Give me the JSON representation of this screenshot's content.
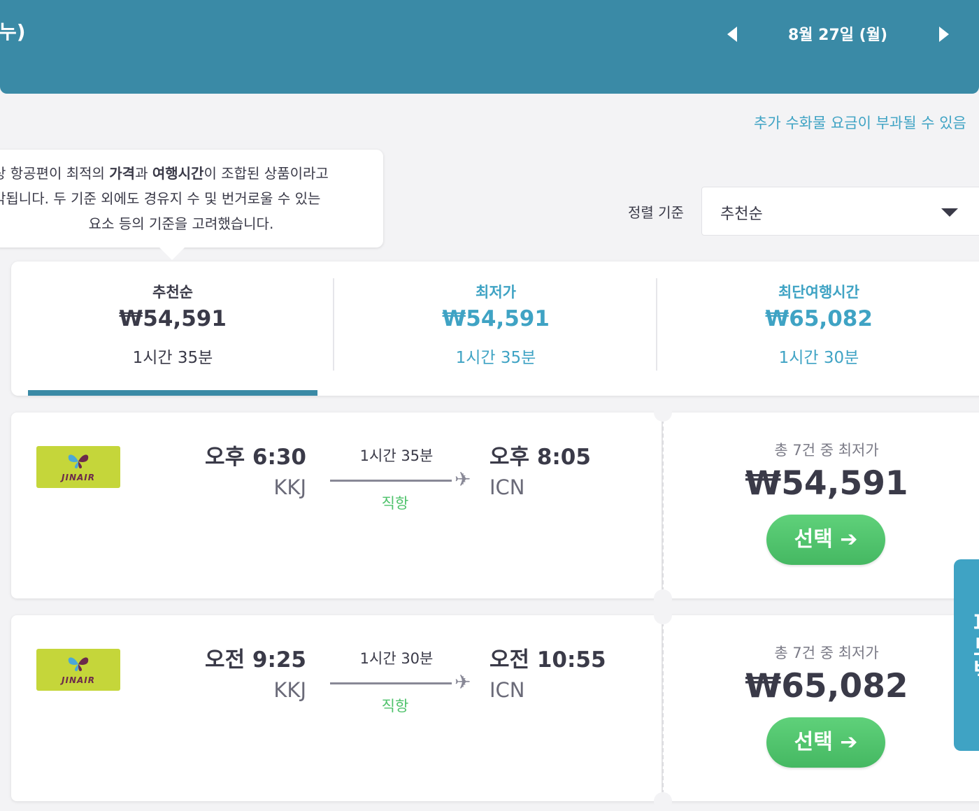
{
  "header": {
    "left_text": "누)",
    "date": "8월 27일 (월)"
  },
  "notice": {
    "baggage": "추가 수화물 요금이 부과될 수 있음"
  },
  "tooltip": {
    "line1_pre": "상 항공편이 최적의 ",
    "line1_b1": "가격",
    "line1_mid": "과 ",
    "line1_b2": "여행시간",
    "line1_post": "이 조합된 상품이라고",
    "line2": "각됩니다. 두 기준 외에도 경유지 수 및 번거로울 수 있는",
    "line3": "요소 등의 기준을 고려했습니다."
  },
  "sort": {
    "label": "정렬 기준",
    "value": "추천순"
  },
  "tabs": [
    {
      "title": "추천순",
      "price": "₩54,591",
      "duration": "1시간 35분"
    },
    {
      "title": "최저가",
      "price": "₩54,591",
      "duration": "1시간 35분"
    },
    {
      "title": "최단여행시간",
      "price": "₩65,082",
      "duration": "1시간 30분"
    }
  ],
  "flights": [
    {
      "airline_logo_text": "JINAIR",
      "dep_time": "오후 6:30",
      "dep_airport": "KKJ",
      "duration": "1시간 35분",
      "type": "직항",
      "arr_time": "오후 8:05",
      "arr_airport": "ICN",
      "offer_count": "총 7건 중 최저가",
      "price": "₩54,591",
      "select_label": "선택"
    },
    {
      "airline_logo_text": "JINAIR",
      "dep_time": "오전 9:25",
      "dep_airport": "KKJ",
      "duration": "1시간 30분",
      "type": "직항",
      "arr_time": "오전 10:55",
      "arr_airport": "ICN",
      "offer_count": "총 7건 중 최저가",
      "price": "₩65,082",
      "select_label": "선택"
    }
  ],
  "side_tab": {
    "label": "피드백"
  },
  "colors": {
    "header": "#3a8aa6",
    "accent": "#3fa3c4",
    "select_button": "#4fc26b",
    "airline_logo": "#c5d63a"
  }
}
